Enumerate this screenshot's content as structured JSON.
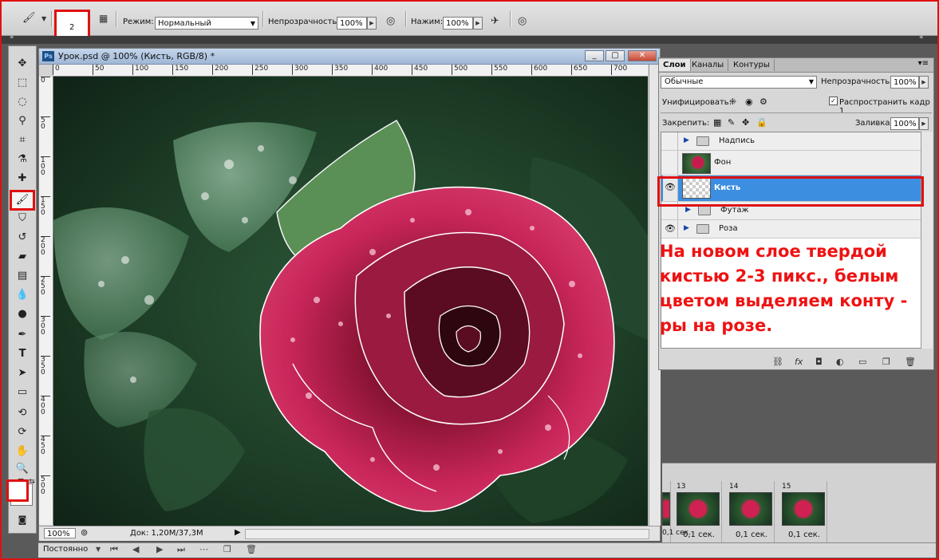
{
  "options_bar": {
    "brush_size": "2",
    "mode_label": "Режим:",
    "mode_value": "Нормальный",
    "opacity_label": "Непрозрачность:",
    "opacity_value": "100%",
    "flow_label": "Нажим:",
    "flow_value": "100%"
  },
  "document": {
    "title": "Урок.psd @ 100% (Кисть, RGB/8) *",
    "ps_badge": "Ps",
    "ruler_h_ticks": [
      "0",
      "50",
      "100",
      "150",
      "200",
      "250",
      "300",
      "350",
      "400",
      "450",
      "500",
      "550",
      "600",
      "650",
      "700"
    ],
    "ruler_v_ticks": [
      "0",
      "50",
      "100",
      "150",
      "200",
      "250",
      "300",
      "350",
      "400",
      "450",
      "500"
    ],
    "zoom": "100%",
    "doc_info": "Док: 1,20M/37,3M"
  },
  "layers_panel": {
    "tabs": [
      "Слои",
      "Каналы",
      "Контуры"
    ],
    "blend_mode": "Обычные",
    "opacity_label": "Непрозрачность:",
    "opacity_value": "100%",
    "unify_label": "Унифицировать:",
    "propagate_label": "Распространить кадр 1",
    "lock_label": "Закрепить:",
    "fill_label": "Заливка:",
    "fill_value": "100%",
    "layers": [
      {
        "name": "Надпись",
        "type": "group",
        "visible": false
      },
      {
        "name": "Фон",
        "type": "image",
        "visible": false
      },
      {
        "name": "Кисть",
        "type": "transparent",
        "visible": true,
        "selected": true
      },
      {
        "name": "Футаж",
        "type": "group",
        "visible": false
      },
      {
        "name": "Роза",
        "type": "group",
        "visible": true
      }
    ]
  },
  "annotation": {
    "line1": "На новом слое твердой",
    "line2": "кистью 2-3 пикс., белым",
    "line3": "цветом выделяем конту -",
    "line4": "ры на розе."
  },
  "animation": {
    "frames": [
      {
        "num": "13",
        "time": "0,1 сек."
      },
      {
        "num": "14",
        "time": "0,1 сек."
      },
      {
        "num": "15",
        "time": "0,1 сек."
      }
    ],
    "partial_time": "0,1 сек."
  },
  "bottom_bar": {
    "loop": "Постоянно"
  },
  "colors": {
    "accent_red": "#e01010",
    "selection_blue": "#3c8ee0",
    "annotation_red": "#ee1212"
  }
}
